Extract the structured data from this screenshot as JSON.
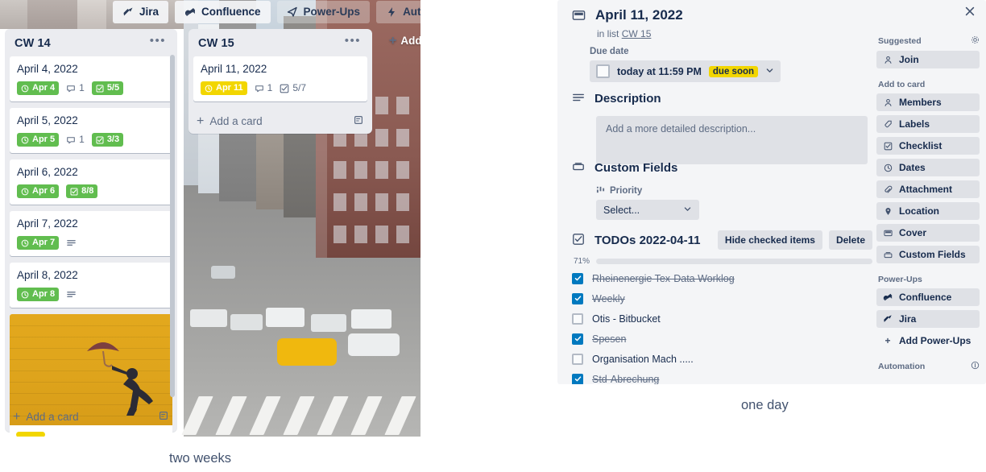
{
  "board": {
    "tabs": [
      {
        "label": "Jira",
        "icon": "jira-icon"
      },
      {
        "label": "Confluence",
        "icon": "confluence-icon"
      },
      {
        "label": "Power-Ups",
        "icon": "powerups-icon"
      },
      {
        "label": "Automation",
        "icon": "automation-icon"
      }
    ],
    "add_button": "Add",
    "lists": [
      {
        "title": "CW 14",
        "add_card": "Add a card",
        "cards": [
          {
            "title": "April 4, 2022",
            "due": "Apr 4",
            "due_color": "green",
            "comments": "1",
            "checklist": "5/5",
            "checklist_color": "green"
          },
          {
            "title": "April 5, 2022",
            "due": "Apr 5",
            "due_color": "green",
            "comments": "1",
            "checklist": "3/3",
            "checklist_color": "green"
          },
          {
            "title": "April 6, 2022",
            "due": "Apr 6",
            "due_color": "green",
            "comments": "",
            "checklist": "8/8",
            "checklist_color": "green"
          },
          {
            "title": "April 7, 2022",
            "due": "Apr 7",
            "due_color": "green",
            "comments": "",
            "checklist": "",
            "checklist_color": "",
            "description": true
          },
          {
            "title": "April 8, 2022",
            "due": "Apr 8",
            "due_color": "green",
            "comments": "",
            "checklist": "",
            "checklist_color": "",
            "description": true
          }
        ]
      },
      {
        "title": "CW 15",
        "add_card": "Add a card",
        "cards": [
          {
            "title": "April 11, 2022",
            "due": "Apr 11",
            "due_color": "yellow",
            "comments": "1",
            "checklist": "5/7",
            "checklist_color": "plain"
          }
        ]
      }
    ]
  },
  "detail": {
    "title": "April 11, 2022",
    "in_list_prefix": "in list",
    "in_list_name": "CW 15",
    "due_date_label": "Due date",
    "due_value": "today at 11:59 PM",
    "due_badge": "due soon",
    "description_heading": "Description",
    "description_placeholder": "Add a more detailed description...",
    "custom_fields_heading": "Custom Fields",
    "priority_label": "Priority",
    "priority_value": "Select...",
    "checklist_title": "TODOs 2022-04-11",
    "hide_checked": "Hide checked items",
    "delete": "Delete",
    "progress_pct": "71%",
    "progress_value": 71,
    "todos": [
      {
        "text": "Rheinenergie Tex-Data Worklog",
        "checked": true
      },
      {
        "text": "Weekly",
        "checked": true
      },
      {
        "text": "Otis - Bitbucket",
        "checked": false
      },
      {
        "text": "Spesen",
        "checked": true
      },
      {
        "text": "Organisation Mach .....",
        "checked": false
      },
      {
        "text": "Std-Abrechung",
        "checked": true
      }
    ],
    "sidebar": {
      "suggested_heading": "Suggested",
      "suggested": [
        {
          "label": "Join",
          "icon": "person-icon"
        }
      ],
      "add_to_card_heading": "Add to card",
      "add_to_card": [
        {
          "label": "Members",
          "icon": "person-icon"
        },
        {
          "label": "Labels",
          "icon": "label-icon"
        },
        {
          "label": "Checklist",
          "icon": "checklist-icon"
        },
        {
          "label": "Dates",
          "icon": "clock-icon"
        },
        {
          "label": "Attachment",
          "icon": "paperclip-icon"
        },
        {
          "label": "Location",
          "icon": "location-pin-icon"
        },
        {
          "label": "Cover",
          "icon": "cover-icon"
        },
        {
          "label": "Custom Fields",
          "icon": "custom-fields-icon"
        }
      ],
      "powerups_heading": "Power-Ups",
      "powerups": [
        {
          "label": "Confluence",
          "icon": "confluence-icon"
        },
        {
          "label": "Jira",
          "icon": "jira-icon"
        }
      ],
      "add_powerups": "Add Power-Ups",
      "automation_heading": "Automation"
    }
  },
  "captions": {
    "left": "two weeks",
    "right": "one day"
  },
  "colors": {
    "green": "#61bd4f",
    "yellow": "#f2d600",
    "blue": "#0079bf",
    "progress": "#5ba4cf",
    "board_list_bg": "#ebecf0",
    "detail_bg": "#f4f5f7",
    "text": "#172b4d",
    "muted": "#5e6c84"
  }
}
